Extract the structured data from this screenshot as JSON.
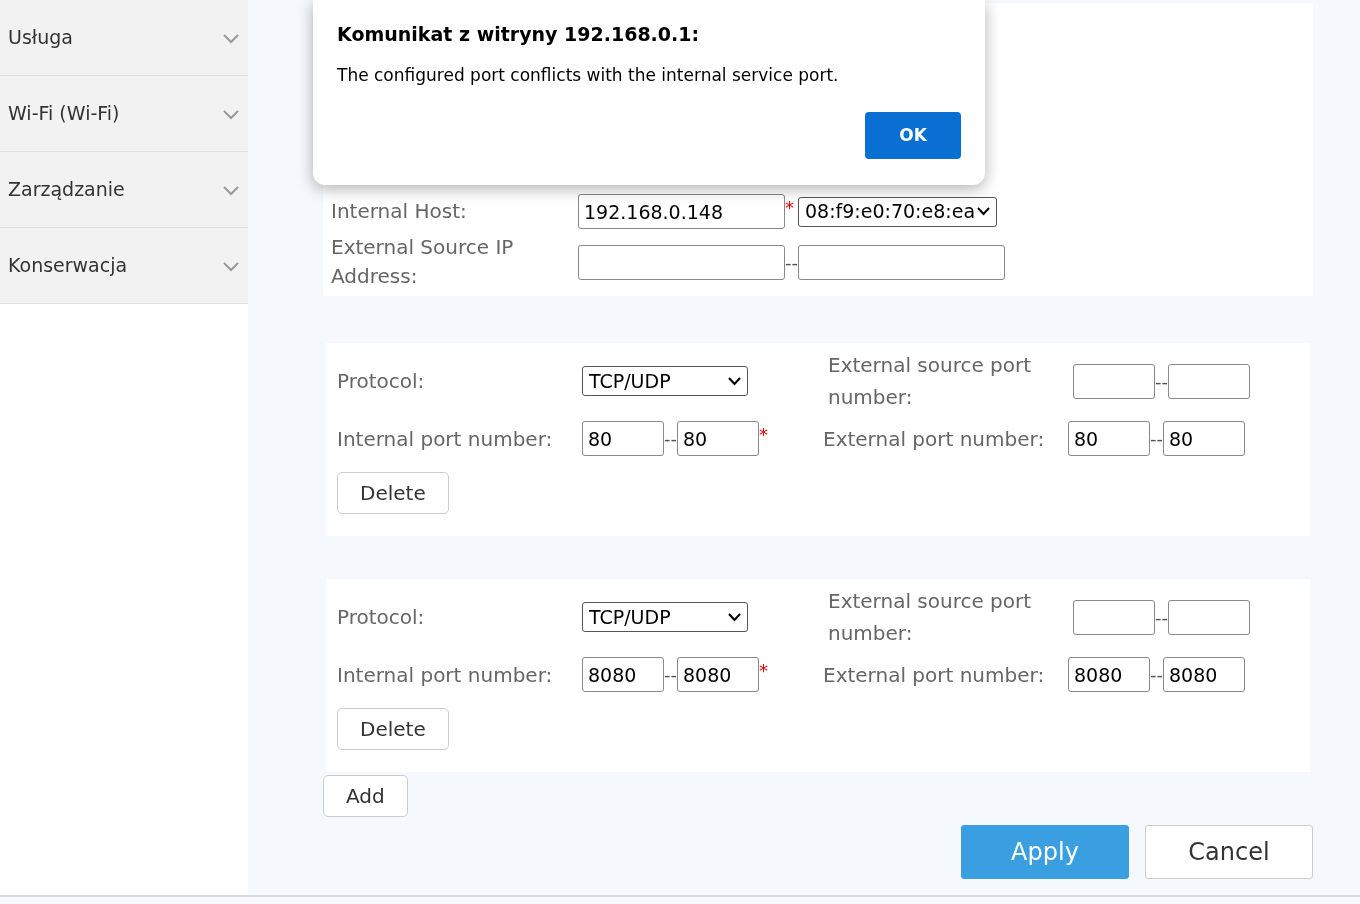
{
  "sidebar": {
    "items": [
      {
        "label": "Usługa",
        "expanded": false
      },
      {
        "label": "Wi-Fi (Wi-Fi)",
        "expanded": false
      },
      {
        "label": "Zarządzanie",
        "expanded": false
      },
      {
        "label": "Konserwacja",
        "expanded": false
      }
    ]
  },
  "host_section": {
    "internal_host": {
      "label": "Internal Host:",
      "ip_value": "192.168.0.148",
      "required_mark": "*",
      "mac_value": "08:f9:e0:70:e8:ea"
    },
    "external_source_ip": {
      "label": "External Source IP Address:",
      "separator": "--"
    }
  },
  "rules": [
    {
      "protocol_label": "Protocol:",
      "protocol": "TCP/UDP",
      "ext_src_label": "External source port number:",
      "ext_src_separator": "--",
      "internal_port_label": "Internal port number:",
      "internal_from": "80",
      "internal_separator": "--",
      "internal_to": "80",
      "required_mark": "*",
      "ext_port_label": "External port number:",
      "ext_from": "80",
      "ext_separator": "--",
      "ext_to": "80",
      "delete_label": "Delete"
    },
    {
      "protocol_label": "Protocol:",
      "protocol": "TCP/UDP",
      "ext_src_label": "External source port number:",
      "ext_src_separator": "--",
      "internal_port_label": "Internal port number:",
      "internal_from": "8080",
      "internal_separator": "--",
      "internal_to": "8080",
      "required_mark": "*",
      "ext_port_label": "External port number:",
      "ext_from": "8080",
      "ext_separator": "--",
      "ext_to": "8080",
      "delete_label": "Delete"
    }
  ],
  "add_label": "Add",
  "apply_label": "Apply",
  "cancel_label": "Cancel",
  "dialog": {
    "title": "Komunikat z witryny 192.168.0.1:",
    "message": "The configured port conflicts with the internal service port.",
    "ok_label": "OK"
  }
}
